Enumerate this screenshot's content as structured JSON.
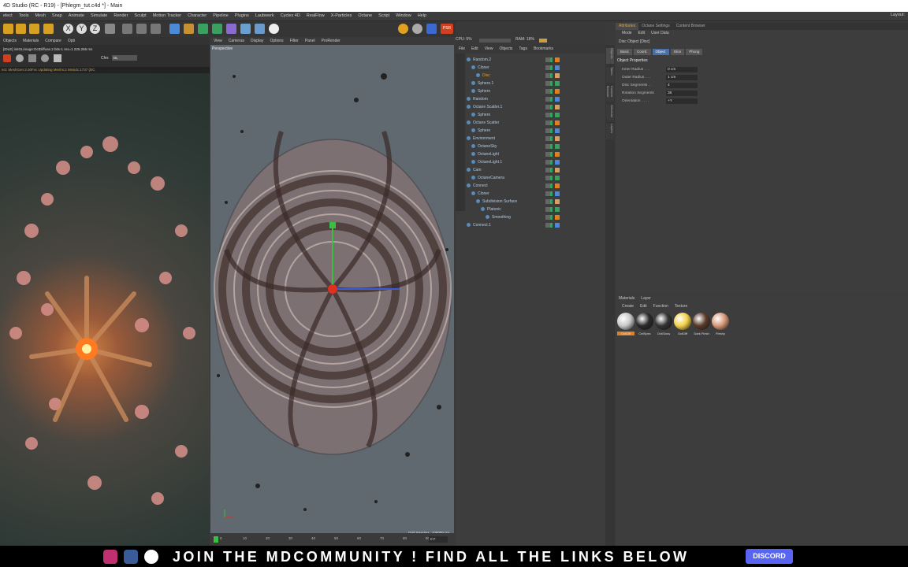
{
  "window": {
    "title": "4D Studio (RC - R19) - [Phlegm_tut.c4d *] - Main",
    "layout_label": "Layout:"
  },
  "menu": [
    "elect",
    "Tools",
    "Mesh",
    "Snap",
    "Animate",
    "Simulate",
    "Render",
    "Sculpt",
    "Motion Tracker",
    "Character",
    "Pipeline",
    "Plugins",
    "Laubwerk",
    "Cycles 4D",
    "RealFlow",
    "X-Particles",
    "Octane",
    "Script",
    "Window",
    "Help"
  ],
  "toolbar": {
    "xyz": [
      "X",
      "Y",
      "Z"
    ],
    "psr_label": "PSR"
  },
  "live_viewer": {
    "menu": [
      "Objects",
      "Materials",
      "Compare",
      "Opti"
    ],
    "status_line": "[IDLE] initGLimage:OctDiffuse.2  bits-1 res=1  225.266 ms",
    "channel_label": "Chn:",
    "channel_value": "DL",
    "progress_line": "ect: MeshGen:2.00Fvc Updating Meshs:2 Mssidc:1737 (DC"
  },
  "viewport": {
    "menu": [
      "View",
      "Cameras",
      "Display",
      "Options",
      "Filter",
      "Panel",
      "ProRender"
    ],
    "title": "Perspective",
    "grid_spacing": "Grid Spacing : 100000 cm",
    "timeline_ticks": [
      "0",
      "10",
      "20",
      "30",
      "40",
      "50",
      "60",
      "70",
      "80",
      "90"
    ],
    "frame": "0 F"
  },
  "object_manager": {
    "cpu_label": "CPU: 5%",
    "ram_label": "RAM: 18%",
    "menu": [
      "File",
      "Edit",
      "View",
      "Objects",
      "Tags",
      "Bookmarks"
    ],
    "objects": [
      {
        "name": "Random.2",
        "indent": 0
      },
      {
        "name": "Cloner",
        "indent": 1
      },
      {
        "name": "Disc",
        "indent": 2
      },
      {
        "name": "Sphere.1",
        "indent": 1
      },
      {
        "name": "Sphere",
        "indent": 1
      },
      {
        "name": "Random",
        "indent": 0
      },
      {
        "name": "Octane Scatter.1",
        "indent": 0
      },
      {
        "name": "Sphere",
        "indent": 1
      },
      {
        "name": "Octane Scatter",
        "indent": 0
      },
      {
        "name": "Sphere",
        "indent": 1
      },
      {
        "name": "Environment",
        "indent": 0
      },
      {
        "name": "OctaneSky",
        "indent": 1
      },
      {
        "name": "OctaneLight",
        "indent": 1
      },
      {
        "name": "OctaneLight.1",
        "indent": 1
      },
      {
        "name": "Cam",
        "indent": 0
      },
      {
        "name": "OctaneCamera",
        "indent": 1
      },
      {
        "name": "Connect",
        "indent": 0
      },
      {
        "name": "Cloner",
        "indent": 1
      },
      {
        "name": "Subdivision Surface",
        "indent": 2
      },
      {
        "name": "Platonic",
        "indent": 3
      },
      {
        "name": "Smoothing",
        "indent": 4
      },
      {
        "name": "Connect.1",
        "indent": 0
      }
    ]
  },
  "side_tabs": [
    "Objects",
    "Takes",
    "Content Browser",
    "Structure",
    "Layers"
  ],
  "attributes": {
    "tabs": [
      "Attributes",
      "Octane Settings",
      "Content Browser"
    ],
    "menu": [
      "Mode",
      "Edit",
      "User Data"
    ],
    "object_title": "Disc Object [Disc]",
    "buttons": [
      "Basic",
      "Coord.",
      "Object",
      "Slice",
      "Phong"
    ],
    "section": "Object Properties",
    "props": [
      {
        "label": "Inner Radius . . .",
        "value": "0 cm"
      },
      {
        "label": "Outer Radius . . .",
        "value": "1 cm"
      },
      {
        "label": "Disc Segments . .",
        "value": "4"
      },
      {
        "label": "Rotation Segments",
        "value": "36"
      },
      {
        "label": "Orientation . . . .",
        "value": "+Y"
      }
    ]
  },
  "materials": {
    "tabs": [
      "Materials",
      "Layer"
    ],
    "menu": [
      "Create",
      "Edit",
      "Function",
      "Texture"
    ],
    "items": [
      {
        "label": "OctDiff",
        "color": "#c8c8c8"
      },
      {
        "label": "OctSpec",
        "color": "#2a2a2a"
      },
      {
        "label": "OctGloss",
        "color": "#333"
      },
      {
        "label": "OctDiff",
        "color": "#f4d048"
      },
      {
        "label": "Dark Flesh",
        "color": "#5a3a2a"
      },
      {
        "label": "Fleshy",
        "color": "#d89878"
      }
    ]
  },
  "banner": {
    "text": "JOIN THE MDCOMMUNITY ! FIND ALL THE LINKS BELOW",
    "discord": "DISCORD"
  }
}
